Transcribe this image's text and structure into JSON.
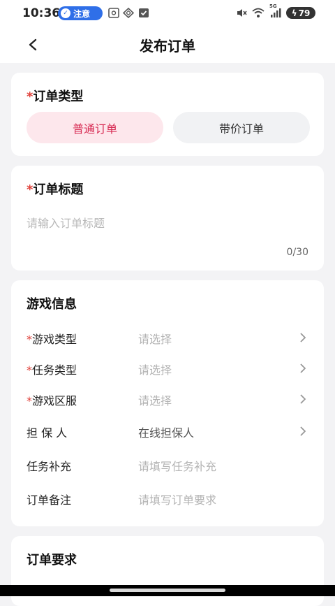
{
  "status_bar": {
    "time": "10:36",
    "notice_label": "注意",
    "network": "5G",
    "battery": "79"
  },
  "header": {
    "title": "发布订单",
    "back_icon": "chevron-left-icon"
  },
  "order_type": {
    "required_mark": "*",
    "title": "订单类型",
    "options": [
      "普通订单",
      "带价订单"
    ],
    "selected": "普通订单",
    "accent_color": "#d72a52"
  },
  "order_title": {
    "required_mark": "*",
    "title": "订单标题",
    "placeholder": "请输入订单标题",
    "value": "",
    "counter": "0/30"
  },
  "game_info": {
    "title": "游戏信息",
    "rows": [
      {
        "required": "*",
        "label": "游戏类型",
        "value": "请选择",
        "has_arrow": true
      },
      {
        "required": "*",
        "label": "任务类型",
        "value": "请选择",
        "has_arrow": true
      },
      {
        "required": "*",
        "label": "游戏区服",
        "value": "请选择",
        "has_arrow": true
      },
      {
        "required": "",
        "label": "担 保 人",
        "value": "在线担保人",
        "has_arrow": true
      },
      {
        "required": "",
        "label": "任务补充",
        "value": "请填写任务补充",
        "has_arrow": false
      },
      {
        "required": "",
        "label": "订单备注",
        "value": "请填写订单要求",
        "has_arrow": false
      }
    ]
  },
  "order_requirements": {
    "title": "订单要求"
  }
}
